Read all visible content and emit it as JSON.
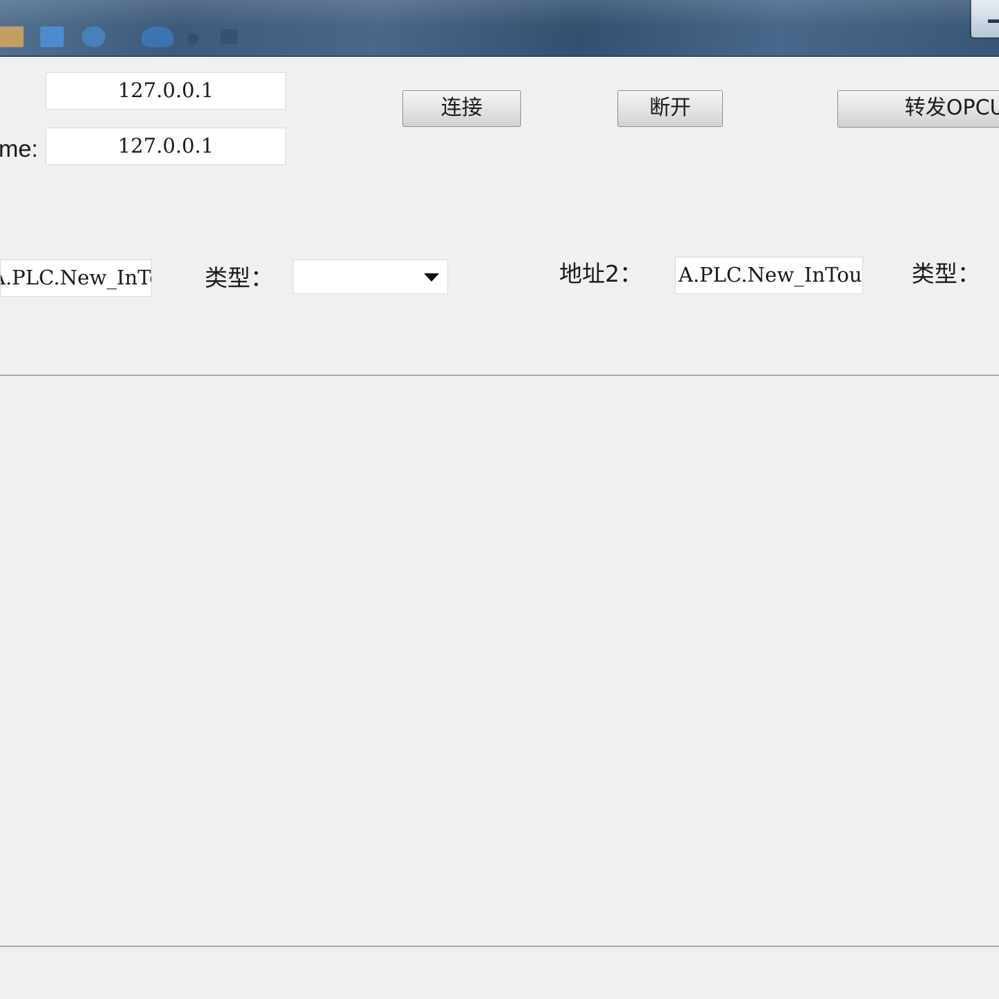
{
  "connection": {
    "host_value": "127.0.0.1",
    "hostname_label": "me:",
    "hostname_value": "127.0.0.1",
    "connect_label": "连接",
    "disconnect_label": "断开",
    "forward_label": "转发OPCUA"
  },
  "row": {
    "address1_value": "A.PLC.New_InTouch",
    "type1_label": "类型：",
    "type1_value": "",
    "address2_label": "地址2：",
    "address2_value": "A.PLC.New_InTouch",
    "type2_label": "类型："
  },
  "icons": [
    "open-icon",
    "save-icon",
    "refresh-icon",
    "undo-icon",
    "redo-icon",
    "dropdown-icon",
    "minimize-icon"
  ]
}
